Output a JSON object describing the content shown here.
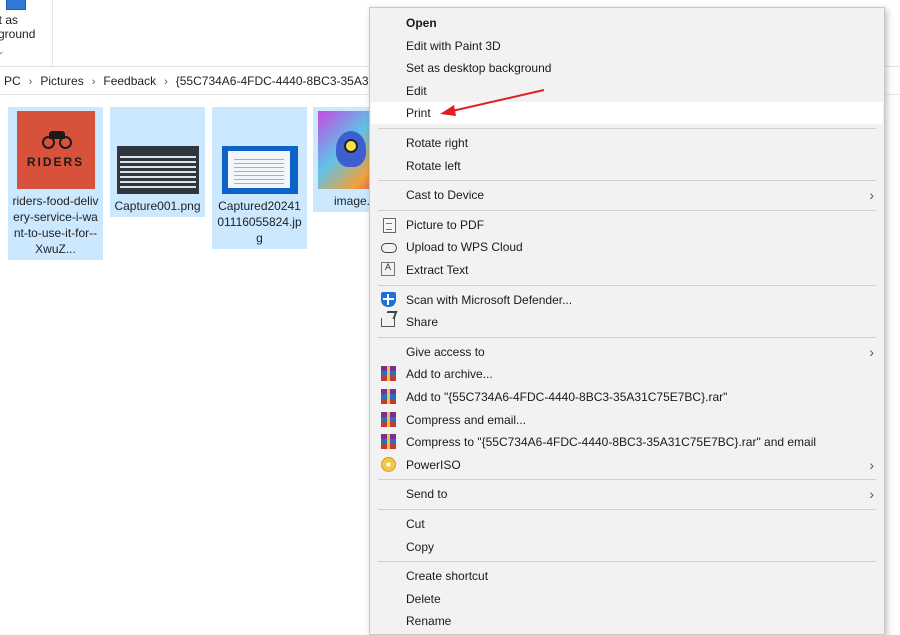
{
  "ribbon": {
    "set_background_label": "et as\nkground",
    "caret": "⌄"
  },
  "address": {
    "crumbs": [
      "PC",
      "Pictures",
      "Feedback",
      "{55C734A6-4FDC-4440-8BC3-35A3"
    ],
    "separator": "›"
  },
  "files": [
    {
      "name": "riders-food-delivery-service-i-want-to-use-it-for--XwuZ...",
      "thumb_text": "RIDERS"
    },
    {
      "name": "Capture001.png"
    },
    {
      "name": "Captured2024101116055824.jpg"
    },
    {
      "name": "image."
    }
  ],
  "menu": {
    "groups": [
      [
        {
          "label": "Open",
          "bold": true
        },
        {
          "label": "Edit with Paint 3D"
        },
        {
          "label": "Set as desktop background"
        },
        {
          "label": "Edit"
        },
        {
          "label": "Print",
          "highlighted": true
        }
      ],
      [
        {
          "label": "Rotate right"
        },
        {
          "label": "Rotate left"
        }
      ],
      [
        {
          "label": "Cast to Device",
          "submenu": true
        }
      ],
      [
        {
          "label": "Picture to PDF",
          "icon": "pdf-icon"
        },
        {
          "label": "Upload to WPS Cloud",
          "icon": "cloud-icon"
        },
        {
          "label": "Extract Text",
          "icon": "extract-text-icon"
        }
      ],
      [
        {
          "label": "Scan with Microsoft Defender...",
          "icon": "defender-icon"
        },
        {
          "label": "Share",
          "icon": "share-icon"
        }
      ],
      [
        {
          "label": "Give access to",
          "submenu": true
        },
        {
          "label": "Add to archive...",
          "icon": "winrar-icon"
        },
        {
          "label": "Add to \"{55C734A6-4FDC-4440-8BC3-35A31C75E7BC}.rar\"",
          "icon": "winrar-icon"
        },
        {
          "label": "Compress and email...",
          "icon": "winrar-icon"
        },
        {
          "label": "Compress to \"{55C734A6-4FDC-4440-8BC3-35A31C75E7BC}.rar\" and email",
          "icon": "winrar-icon"
        },
        {
          "label": "PowerISO",
          "icon": "poweriso-icon",
          "submenu": true
        }
      ],
      [
        {
          "label": "Send to",
          "submenu": true
        }
      ],
      [
        {
          "label": "Cut"
        },
        {
          "label": "Copy"
        }
      ],
      [
        {
          "label": "Create shortcut"
        },
        {
          "label": "Delete"
        },
        {
          "label": "Rename"
        }
      ]
    ],
    "submenu_arrow": "›"
  },
  "colors": {
    "selection": "#cce8ff",
    "menu_bg": "#f2f2f2",
    "annotation_arrow": "#e02020"
  }
}
